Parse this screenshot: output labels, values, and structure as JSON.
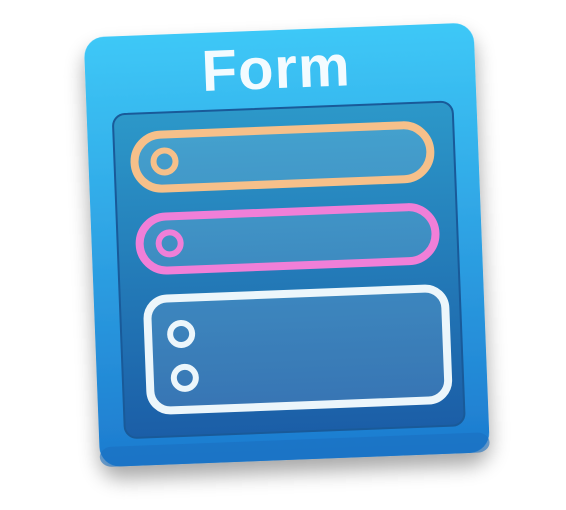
{
  "icon": {
    "title": "Form",
    "name": "form-app-icon",
    "colors": {
      "card_top": "#39c3f5",
      "card_bottom": "#1f7fd0",
      "panel_top": "#2a93c8",
      "panel_bottom": "#1c5fa8",
      "field_1_stroke": "#f6c08a",
      "field_2_stroke": "#f07fd8",
      "field_3_stroke": "#ecf6fb",
      "title_color": "#f3fbff"
    },
    "fields": [
      {
        "name": "text-field-orange",
        "stroke_color": "#f6c08a",
        "radio_count": 1
      },
      {
        "name": "text-field-pink",
        "stroke_color": "#f07fd8",
        "radio_count": 1
      },
      {
        "name": "text-area-white",
        "stroke_color": "#ecf6fb",
        "radio_count": 2
      }
    ]
  }
}
